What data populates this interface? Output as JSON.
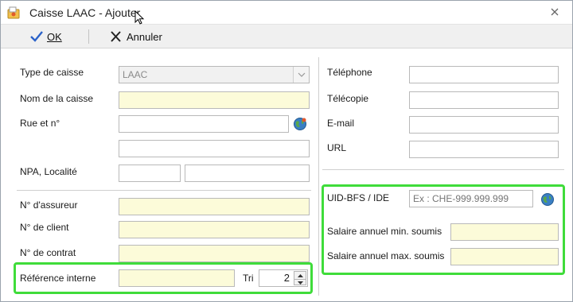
{
  "window": {
    "title": "Caisse LAAC - Ajouter"
  },
  "toolbar": {
    "ok_label": "OK",
    "cancel_label": "Annuler"
  },
  "left": {
    "type_label": "Type de caisse",
    "type_value": "LAAC",
    "nom_label": "Nom de la caisse",
    "nom_value": "",
    "rue_label": "Rue et n°",
    "rue_value": "",
    "rue2_value": "",
    "npa_label": "NPA, Localité",
    "npa_value": "",
    "localite_value": "",
    "assureur_label": "N° d'assureur",
    "assureur_value": "",
    "client_label": "N° de client",
    "client_value": "",
    "contrat_label": "N° de contrat",
    "contrat_value": "",
    "reference_label": "Référence interne",
    "reference_value": "",
    "tri_label": "Tri",
    "tri_value": "2"
  },
  "right": {
    "telephone_label": "Téléphone",
    "telephone_value": "",
    "telecopie_label": "Télécopie",
    "telecopie_value": "",
    "email_label": "E-mail",
    "email_value": "",
    "url_label": "URL",
    "url_value": "",
    "uid_label": "UID-BFS / IDE",
    "uid_placeholder": "Ex : CHE-999.999.999",
    "salaire_min_label": "Salaire annuel min. soumis",
    "salaire_min_value": "",
    "salaire_max_label": "Salaire annuel max. soumis",
    "salaire_max_value": ""
  },
  "icons": {
    "app": "app-icon",
    "close": "close-icon",
    "ok": "checkmark-icon",
    "cancel": "x-icon",
    "globe": "globe-icon",
    "dropdown": "chevron-down-icon",
    "spin": "spinner-arrows-icon"
  },
  "colors": {
    "required_field": "#fcfbd9",
    "highlight": "#3fdc3a",
    "toolbar": "#f0f0f0"
  }
}
